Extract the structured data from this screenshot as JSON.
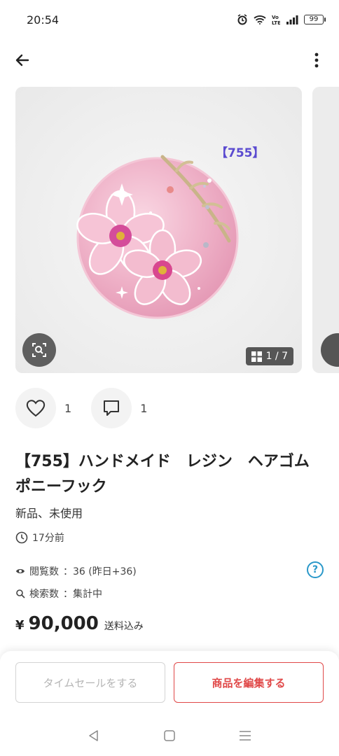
{
  "status_bar": {
    "time": "20:54",
    "battery": "99",
    "icons": [
      "alarm-icon",
      "wifi-icon",
      "volte-icon",
      "signal-icon",
      "battery-icon"
    ]
  },
  "app_bar": {
    "icons": [
      "back-arrow-icon",
      "more-vertical-icon"
    ]
  },
  "gallery": {
    "tag_text": "【755】",
    "counter": "1 / 7",
    "icons": [
      "zoom-search-icon",
      "grid-icon"
    ]
  },
  "actions": {
    "likes": "1",
    "comments": "1",
    "icons": [
      "heart-icon",
      "comment-icon"
    ]
  },
  "item": {
    "title": "【755】ハンドメイド　レジン　ヘアゴム　ポニーフック",
    "condition": "新品、未使用",
    "posted": "17分前"
  },
  "stats": {
    "views_label": "閲覧数",
    "views_value": "：36 (昨日+36)",
    "search_label": "検索数",
    "search_value": "：集計中",
    "help": "?"
  },
  "price": {
    "currency": "¥",
    "amount": "90,000",
    "shipping": "送料込み"
  },
  "bottom": {
    "time_sale_label": "タイムセールをする",
    "edit_label": "商品を編集する"
  },
  "colors": {
    "accent_red": "#e04848",
    "help_blue": "#2a98c9",
    "tag_purple": "#5b4bd0"
  }
}
